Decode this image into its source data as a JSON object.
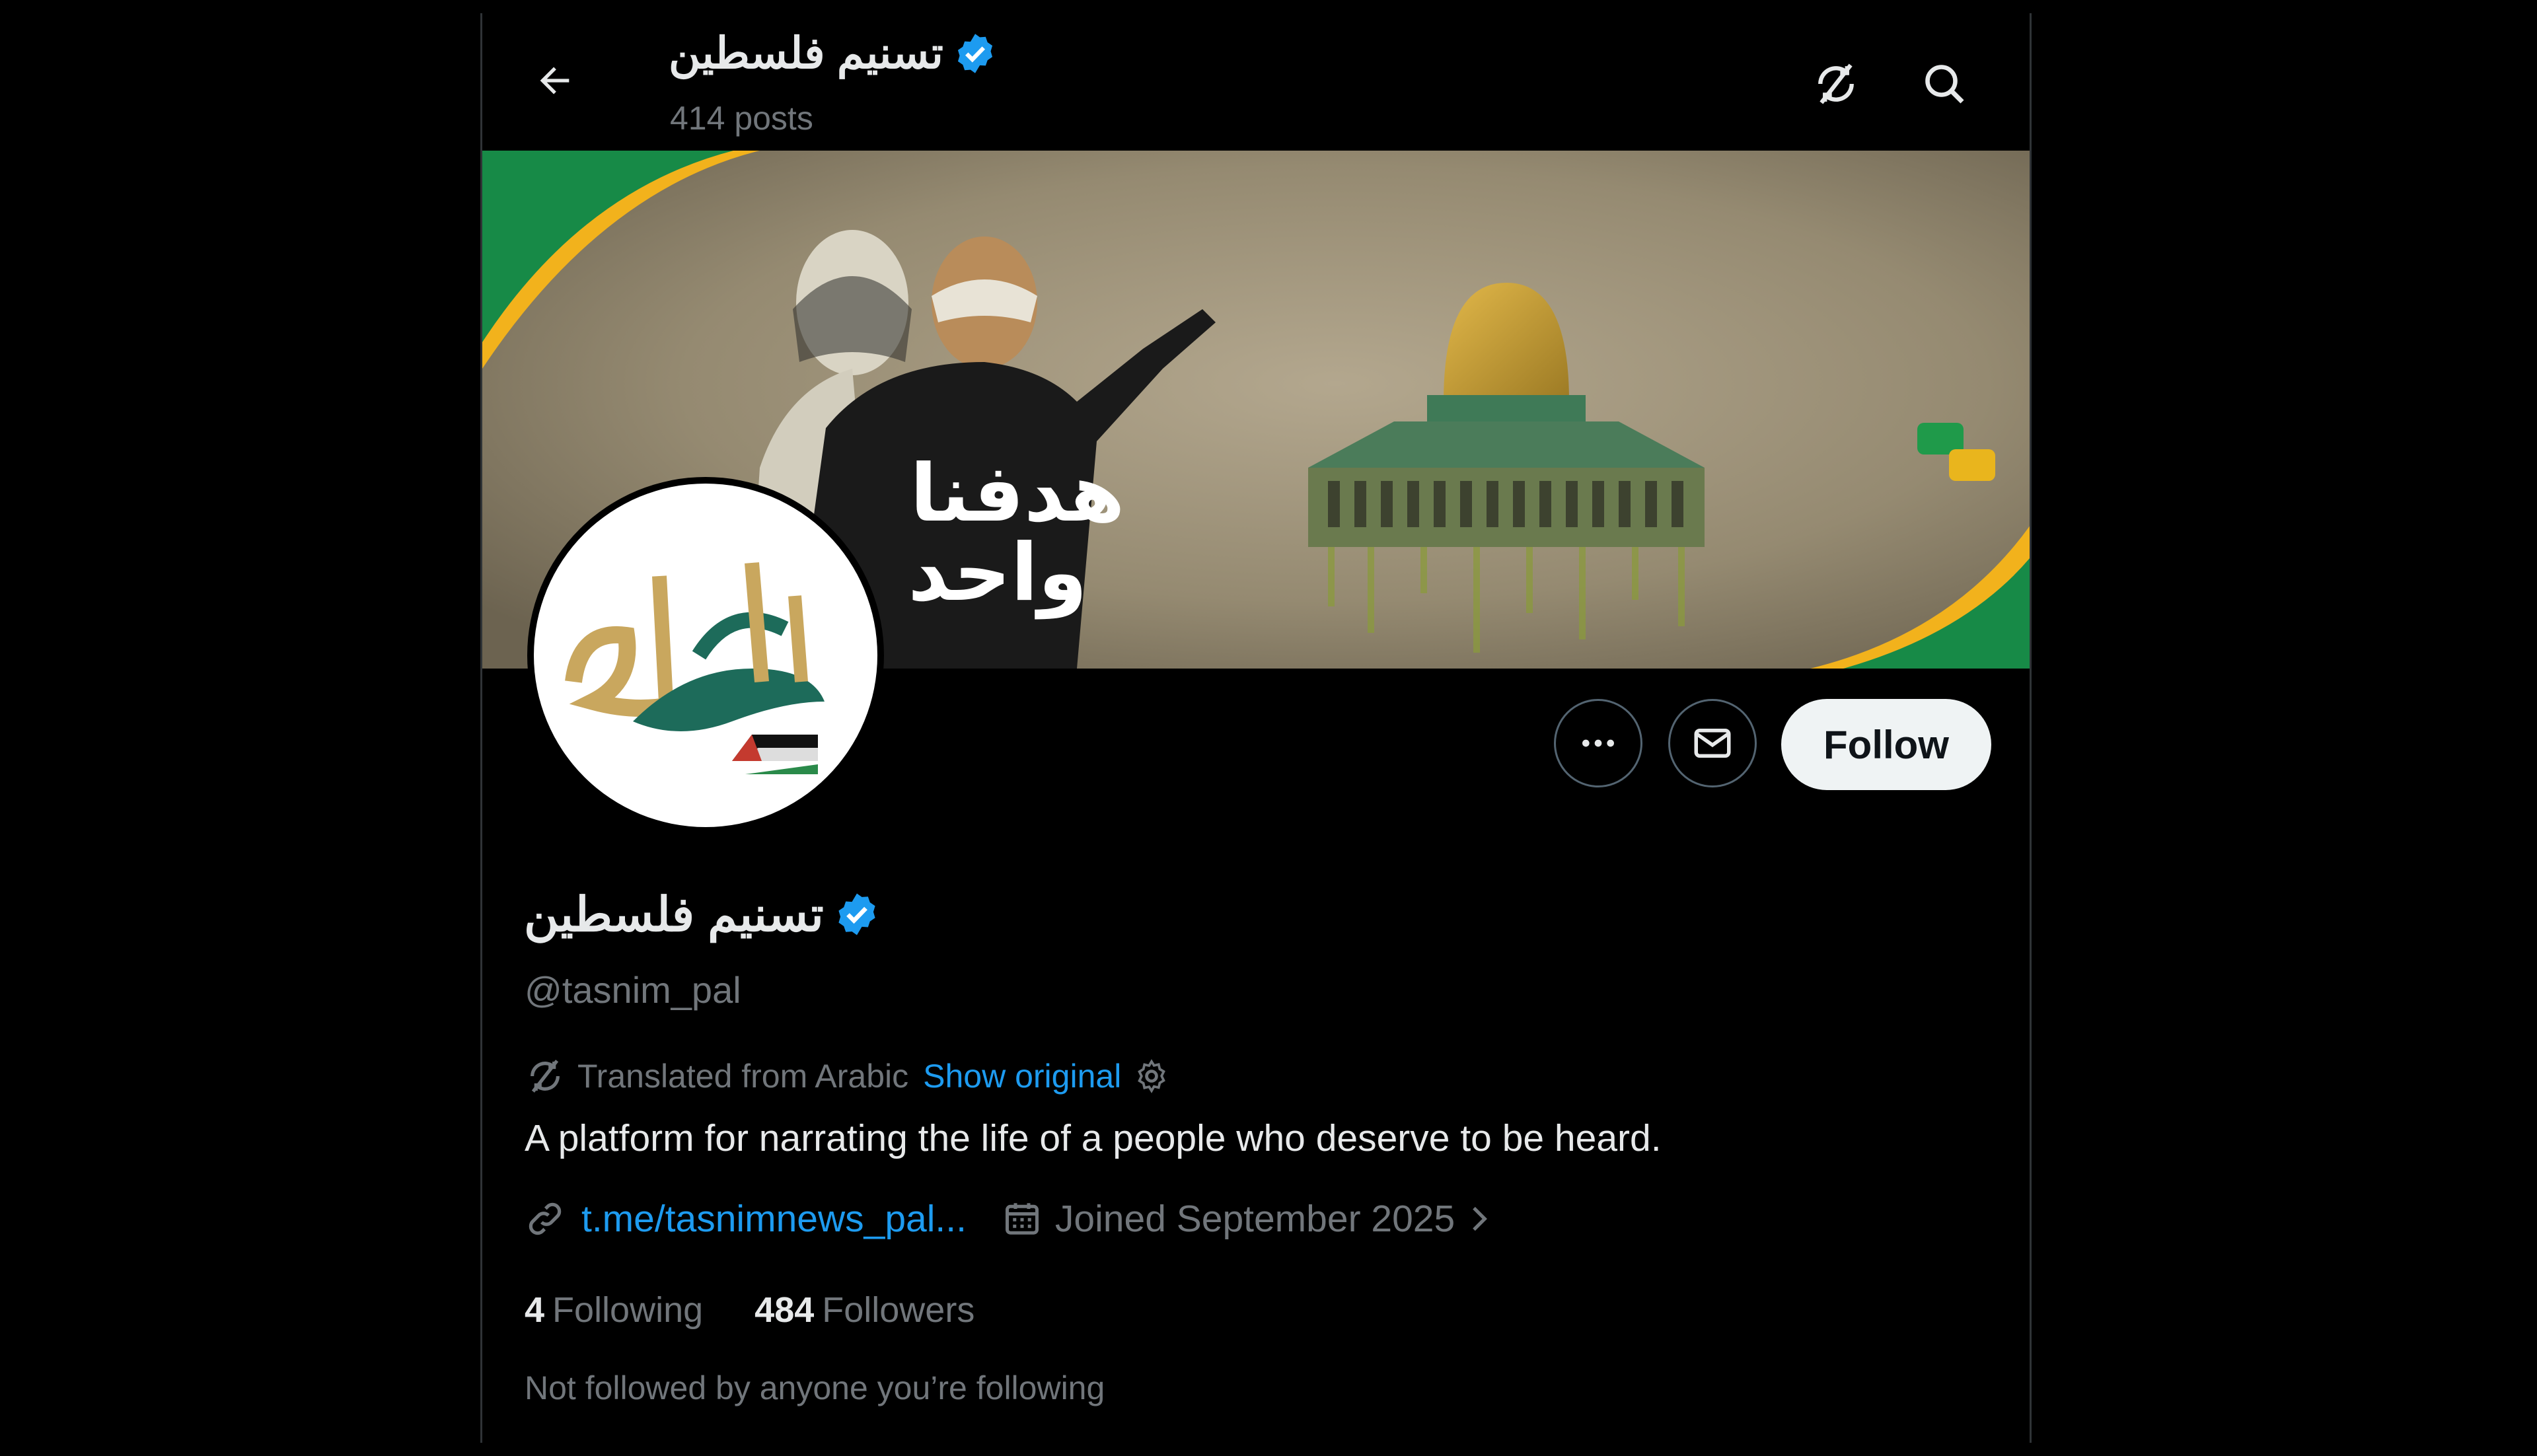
{
  "header": {
    "name": "تسنيم فلسطين",
    "posts": "414 posts"
  },
  "banner": {
    "shirt_text_line1": "هدفنا",
    "shirt_text_line2": "واحد"
  },
  "profile": {
    "name": "تسنيم فلسطين",
    "handle": "@tasnim_pal",
    "translated_label": "Translated from Arabic",
    "show_original": "Show original",
    "bio": "A platform for narrating the life of a people who deserve to be heard.",
    "url": "t.me/tasnimnews_pal...",
    "joined": "Joined September 2025",
    "following_count": "4",
    "following_label": "Following",
    "followers_count": "484",
    "followers_label": "Followers",
    "not_followed": "Not followed by anyone you’re following"
  },
  "actions": {
    "follow_label": "Follow"
  },
  "colors": {
    "background": "#000000",
    "accent_blue": "#1d9bf0",
    "muted_text": "#71767b",
    "follow_button": "#eff3f4"
  },
  "icons": [
    "back-arrow-icon",
    "translate-off-icon",
    "search-icon",
    "verified-badge-icon",
    "more-icon",
    "envelope-icon",
    "link-icon",
    "calendar-icon",
    "gear-icon",
    "chevron-right-icon"
  ]
}
